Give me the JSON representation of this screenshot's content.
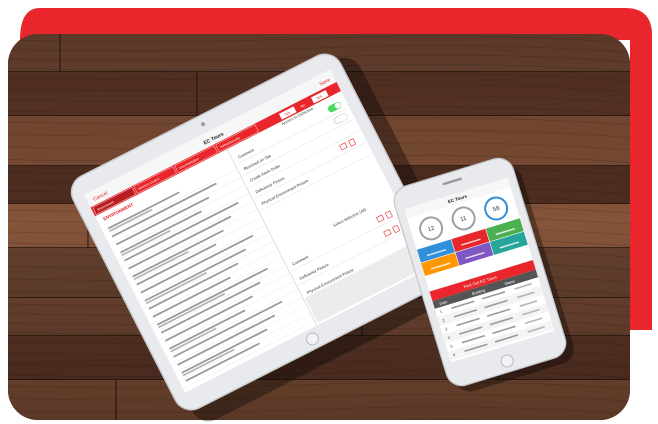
{
  "colors": {
    "accent_red": "#e8262b",
    "wood_dark": "#3b2418",
    "wood_mid": "#6b4330",
    "wood_light": "#8a5a3e",
    "device_silver": "#e6e7ea",
    "screen_white": "#ffffff",
    "toggle_green": "#4cd964"
  },
  "tablet": {
    "nav_cancel": "Cancel",
    "nav_title": "EC Tours",
    "nav_save": "Save",
    "segments": [
      "Yes",
      "No",
      "N/A"
    ],
    "tabs": [
      "Environment",
      "Infection Control",
      "Documentation",
      "Safety/Security"
    ],
    "section_heading": "ENVIRONMENT",
    "row_labels": [
      "Comment",
      "Resolved on Site",
      "Create Work Order",
      "Deficiency Picture",
      "Physical Environment Picture",
      "Comment",
      "Deficiency Picture",
      "Physical Environment Picture"
    ],
    "right_header": "Access to Defective",
    "right_note": "Select defective (All)"
  },
  "phone": {
    "nav_title": "EC Tours",
    "stat_values": [
      "12",
      "11",
      "58"
    ],
    "action_button": "Find Out EC Tours",
    "table_headers": [
      "Date",
      "Building",
      "Status"
    ],
    "rows": [
      "1",
      "2",
      "3",
      "4",
      "5",
      "6"
    ]
  }
}
